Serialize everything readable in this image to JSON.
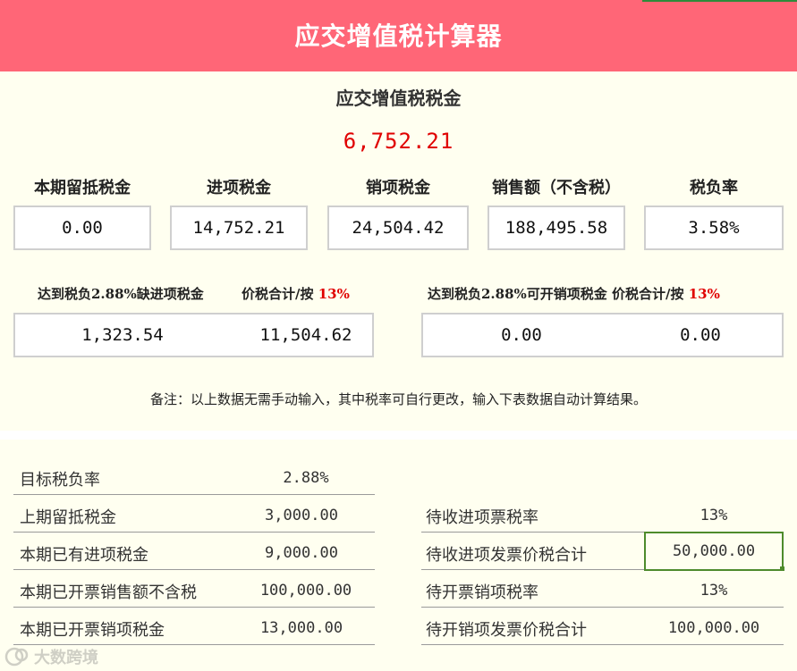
{
  "header": {
    "title": "应交增值税计算器"
  },
  "summary": {
    "label": "应交增值税税金",
    "value": "6,752.21"
  },
  "metrics": [
    {
      "label": "本期留抵税金",
      "value": "0.00"
    },
    {
      "label": "进项税金",
      "value": "14,752.21"
    },
    {
      "label": "销项税金",
      "value": "24,504.42"
    },
    {
      "label": "销售额（不含税）",
      "value": "188,495.58"
    },
    {
      "label": "税负率",
      "value": "3.58%"
    }
  ],
  "left_block": {
    "label1": "达到税负2.88%缺进项税金",
    "label2": "价税合计/按",
    "rate": "13%",
    "value1": "1,323.54",
    "value2": "11,504.62"
  },
  "right_block": {
    "label1": "达到税负2.88%可开销项税金",
    "label2": "价税合计/按",
    "rate": "13%",
    "value1": "0.00",
    "value2": "0.00"
  },
  "note": "备注：以上数据无需手动输入，其中税率可自行更改，输入下表数据自动计算结果。",
  "inputs_left": [
    {
      "label": "目标税负率",
      "value": "2.88%"
    },
    {
      "label": "上期留抵税金",
      "value": "3,000.00"
    },
    {
      "label": "本期已有进项税金",
      "value": "9,000.00"
    },
    {
      "label": "本期已开票销售额不含税",
      "value": "100,000.00"
    },
    {
      "label": "本期已开票销项税金",
      "value": "13,000.00"
    }
  ],
  "inputs_right": [
    {
      "label": "待收进项票税率",
      "value": "13%"
    },
    {
      "label": "待收进项发票价税合计",
      "value": "50,000.00"
    },
    {
      "label": "待开票销项税率",
      "value": "13%"
    },
    {
      "label": "待开销项发票价税合计",
      "value": "100,000.00"
    }
  ],
  "watermark": {
    "text": "大数跨境"
  },
  "colors": {
    "banner": "#ff6677",
    "highlight": "#e00000",
    "selection": "#4e8b2c",
    "background": "#fffff0"
  }
}
